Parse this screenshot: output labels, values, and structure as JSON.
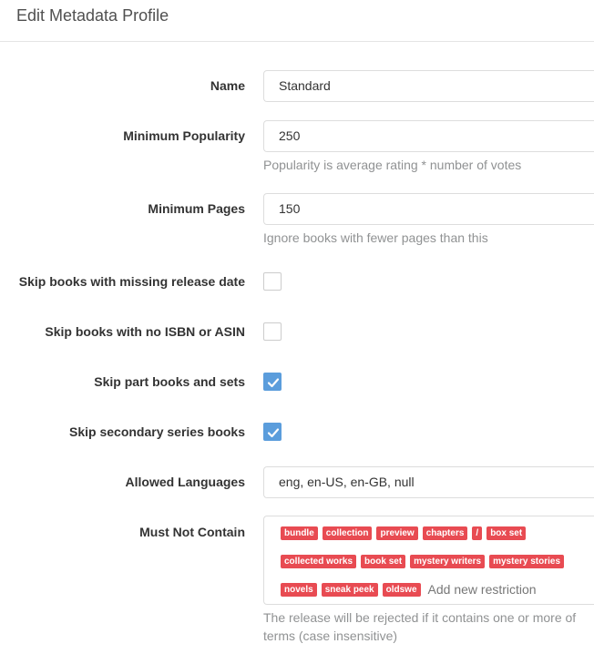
{
  "header": {
    "title": "Edit Metadata Profile"
  },
  "fields": {
    "name": {
      "label": "Name",
      "value": "Standard"
    },
    "min_popularity": {
      "label": "Minimum Popularity",
      "value": "250",
      "help": "Popularity is average rating * number of votes"
    },
    "min_pages": {
      "label": "Minimum Pages",
      "value": "150",
      "help": "Ignore books with fewer pages than this"
    },
    "skip_missing_date": {
      "label": "Skip books with missing release date",
      "checked": false
    },
    "skip_no_isbn": {
      "label": "Skip books with no ISBN or ASIN",
      "checked": false
    },
    "skip_part_books": {
      "label": "Skip part books and sets",
      "checked": true
    },
    "skip_secondary": {
      "label": "Skip secondary series books",
      "checked": true
    },
    "allowed_languages": {
      "label": "Allowed Languages",
      "value": "eng, en-US, en-GB, null"
    },
    "must_not_contain": {
      "label": "Must Not Contain",
      "tags_row1": [
        "bundle",
        "collection",
        "preview",
        "chapters",
        "/",
        "box set"
      ],
      "tags_row2": [
        "collected works",
        "book set",
        "mystery writers",
        "mystery stories"
      ],
      "tags_row3": [
        "novels",
        "sneak peek",
        "oldswe"
      ],
      "placeholder": "Add new restriction",
      "help_line1": "The release will be rejected if it contains one or more of",
      "help_line2": "terms (case insensitive)"
    }
  },
  "colors": {
    "tag": "#e84b52",
    "checkbox_checked": "#5b9ddc"
  }
}
